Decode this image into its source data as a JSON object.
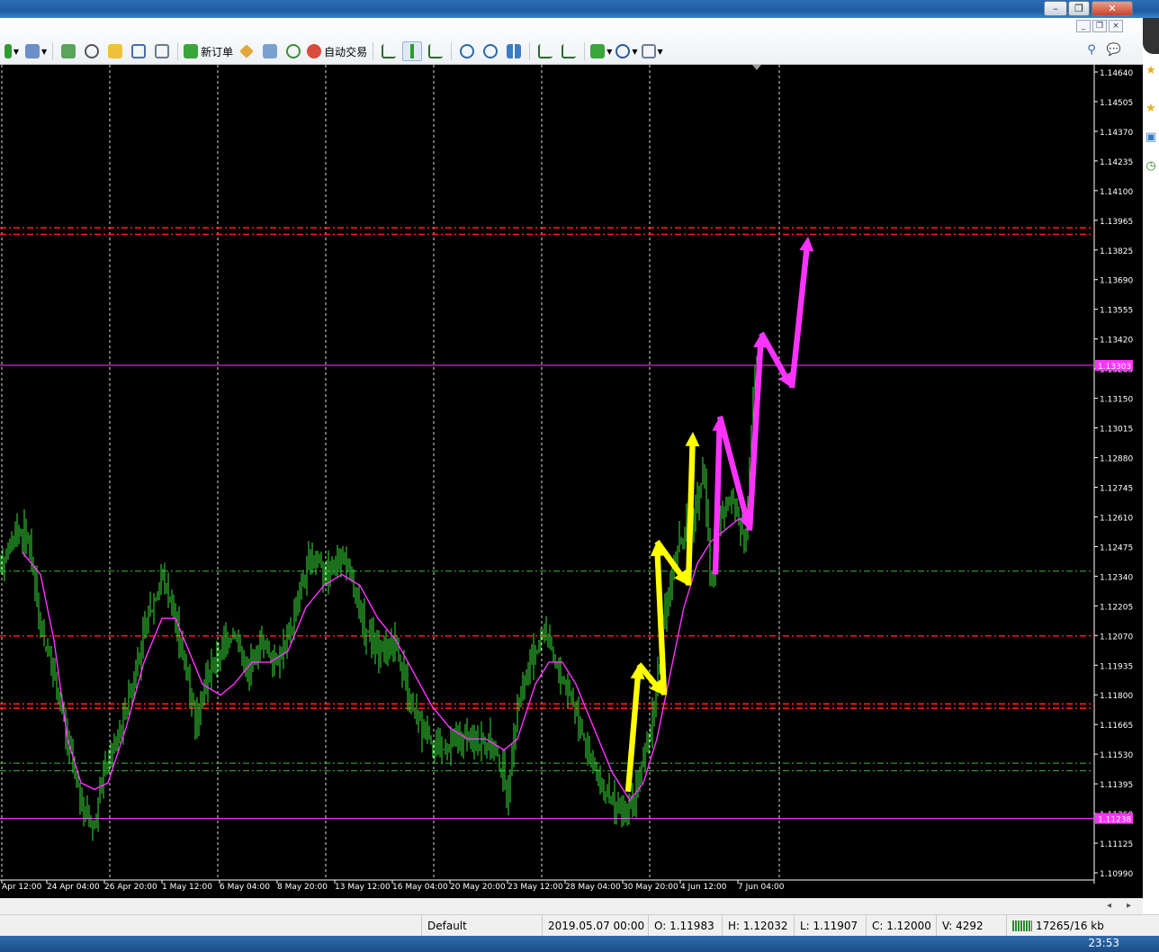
{
  "window": {
    "minimize_glyph": "–",
    "restore_glyph": "❐",
    "close_glyph": "✕"
  },
  "mdi": {
    "minimize_glyph": "_",
    "restore_glyph": "❐",
    "close_glyph": "×"
  },
  "toolbar": {
    "new_order_label": "新订单",
    "auto_trading_label": "自动交易"
  },
  "chart_data": {
    "type": "candlestick",
    "y_ticks": [
      "1.14640",
      "1.14505",
      "1.14370",
      "1.14235",
      "1.14100",
      "1.13965",
      "1.13825",
      "1.13690",
      "1.13555",
      "1.13420",
      "1.13285",
      "1.13150",
      "1.13015",
      "1.12880",
      "1.12745",
      "1.12610",
      "1.12475",
      "1.12340",
      "1.12205",
      "1.12070",
      "1.11935",
      "1.11800",
      "1.11665",
      "1.11530",
      "1.11395",
      "1.11260",
      "1.11125",
      "1.10990"
    ],
    "x_ticks": [
      "Apr 12:00",
      "24 Apr 04:00",
      "26 Apr 20:00",
      "1 May 12:00",
      "6 May 04:00",
      "8 May 20:00",
      "13 May 12:00",
      "16 May 04:00",
      "20 May 20:00",
      "23 May 12:00",
      "28 May 04:00",
      "30 May 20:00",
      "4 Jun 12:00",
      "7 Jun 04:00"
    ],
    "ylim": [
      1.1099,
      1.1464
    ],
    "price_labels": [
      "1.13303",
      "1.11238"
    ],
    "horizontal_lines": [
      {
        "price": 1.1393,
        "color": "#ff2020",
        "style": "dashdot"
      },
      {
        "price": 1.139,
        "color": "#ff2020",
        "style": "dashdot"
      },
      {
        "price": 1.13303,
        "color": "#ff33ff",
        "style": "solid"
      },
      {
        "price": 1.12365,
        "color": "#3cb43c",
        "style": "dashdot"
      },
      {
        "price": 1.1207,
        "color": "#ff2020",
        "style": "dashdot"
      },
      {
        "price": 1.1176,
        "color": "#ff2020",
        "style": "dashdot"
      },
      {
        "price": 1.1174,
        "color": "#ff2020",
        "style": "dashdot"
      },
      {
        "price": 1.1149,
        "color": "#3cb43c",
        "style": "dashdot"
      },
      {
        "price": 1.11455,
        "color": "#3cb43c",
        "style": "dashdot"
      },
      {
        "price": 1.11238,
        "color": "#ff33ff",
        "style": "solid"
      }
    ],
    "candle_color": "#39e039",
    "ma_color": "#ff33ff",
    "price_path": [
      [
        0,
        1.124
      ],
      [
        20,
        1.1255
      ],
      [
        32,
        1.1252
      ],
      [
        45,
        1.121
      ],
      [
        60,
        1.119
      ],
      [
        75,
        1.116
      ],
      [
        90,
        1.113
      ],
      [
        105,
        1.112
      ],
      [
        115,
        1.1145
      ],
      [
        130,
        1.116
      ],
      [
        150,
        1.119
      ],
      [
        165,
        1.1215
      ],
      [
        180,
        1.1235
      ],
      [
        192,
        1.122
      ],
      [
        205,
        1.1195
      ],
      [
        218,
        1.117
      ],
      [
        232,
        1.119
      ],
      [
        245,
        1.12
      ],
      [
        260,
        1.121
      ],
      [
        275,
        1.119
      ],
      [
        290,
        1.1205
      ],
      [
        305,
        1.1195
      ],
      [
        320,
        1.1205
      ],
      [
        335,
        1.123
      ],
      [
        350,
        1.1245
      ],
      [
        365,
        1.1235
      ],
      [
        380,
        1.1245
      ],
      [
        392,
        1.123
      ],
      [
        405,
        1.121
      ],
      [
        420,
        1.12
      ],
      [
        440,
        1.1205
      ],
      [
        455,
        1.1175
      ],
      [
        470,
        1.1165
      ],
      [
        490,
        1.1155
      ],
      [
        510,
        1.116
      ],
      [
        530,
        1.116
      ],
      [
        550,
        1.1155
      ],
      [
        565,
        1.1135
      ],
      [
        575,
        1.1175
      ],
      [
        590,
        1.1195
      ],
      [
        605,
        1.121
      ],
      [
        620,
        1.119
      ],
      [
        635,
        1.118
      ],
      [
        650,
        1.116
      ],
      [
        665,
        1.114
      ],
      [
        680,
        1.113
      ],
      [
        695,
        1.1125
      ],
      [
        710,
        1.114
      ],
      [
        725,
        1.117
      ],
      [
        740,
        1.122
      ],
      [
        755,
        1.125
      ],
      [
        770,
        1.126
      ],
      [
        782,
        1.1285
      ],
      [
        790,
        1.123
      ],
      [
        800,
        1.126
      ],
      [
        815,
        1.127
      ],
      [
        828,
        1.125
      ],
      [
        838,
        1.132
      ],
      [
        845,
        1.1335
      ]
    ],
    "ma_path": [
      [
        25,
        1.1245
      ],
      [
        45,
        1.1235
      ],
      [
        60,
        1.1205
      ],
      [
        75,
        1.116
      ],
      [
        90,
        1.114
      ],
      [
        105,
        1.1137
      ],
      [
        120,
        1.114
      ],
      [
        140,
        1.1165
      ],
      [
        160,
        1.1195
      ],
      [
        180,
        1.1215
      ],
      [
        195,
        1.1215
      ],
      [
        210,
        1.12
      ],
      [
        225,
        1.1185
      ],
      [
        245,
        1.118
      ],
      [
        260,
        1.1185
      ],
      [
        280,
        1.1195
      ],
      [
        300,
        1.1195
      ],
      [
        320,
        1.12
      ],
      [
        340,
        1.122
      ],
      [
        360,
        1.123
      ],
      [
        380,
        1.1235
      ],
      [
        400,
        1.123
      ],
      [
        420,
        1.1215
      ],
      [
        440,
        1.1205
      ],
      [
        460,
        1.119
      ],
      [
        480,
        1.1175
      ],
      [
        500,
        1.1165
      ],
      [
        520,
        1.116
      ],
      [
        540,
        1.116
      ],
      [
        560,
        1.1155
      ],
      [
        575,
        1.116
      ],
      [
        595,
        1.1185
      ],
      [
        610,
        1.1195
      ],
      [
        625,
        1.1195
      ],
      [
        640,
        1.1185
      ],
      [
        660,
        1.1165
      ],
      [
        680,
        1.1145
      ],
      [
        700,
        1.1132
      ],
      [
        715,
        1.114
      ],
      [
        730,
        1.116
      ],
      [
        745,
        1.119
      ],
      [
        760,
        1.122
      ],
      [
        775,
        1.124
      ],
      [
        790,
        1.125
      ],
      [
        805,
        1.1255
      ],
      [
        820,
        1.126
      ],
      [
        835,
        1.126
      ]
    ],
    "arrows": [
      {
        "color": "#ffff00",
        "points": [
          [
            698,
            1.1136
          ],
          [
            710,
            1.1194
          ]
        ]
      },
      {
        "color": "#ffff00",
        "points": [
          [
            710,
            1.1194
          ],
          [
            738,
            1.118
          ]
        ]
      },
      {
        "color": "#ffff00",
        "points": [
          [
            738,
            1.118
          ],
          [
            730,
            1.125
          ]
        ]
      },
      {
        "color": "#ffff00",
        "points": [
          [
            730,
            1.125
          ],
          [
            765,
            1.123
          ]
        ]
      },
      {
        "color": "#ffff00",
        "points": [
          [
            765,
            1.123
          ],
          [
            770,
            1.13
          ]
        ]
      },
      {
        "color": "#ff33ff",
        "points": [
          [
            795,
            1.1235
          ],
          [
            800,
            1.1307
          ]
        ]
      },
      {
        "color": "#ff33ff",
        "points": [
          [
            800,
            1.1307
          ],
          [
            833,
            1.1255
          ]
        ]
      },
      {
        "color": "#ff33ff",
        "points": [
          [
            833,
            1.1255
          ],
          [
            846,
            1.1345
          ]
        ]
      },
      {
        "color": "#ff33ff",
        "points": [
          [
            846,
            1.1345
          ],
          [
            880,
            1.132
          ]
        ]
      },
      {
        "color": "#ff33ff",
        "points": [
          [
            880,
            1.132
          ],
          [
            898,
            1.1389
          ]
        ]
      }
    ]
  },
  "status": {
    "profile": "Default",
    "datetime": "2019.05.07 00:00",
    "open": "O: 1.11983",
    "high": "H: 1.12032",
    "low": "L: 1.11907",
    "close": "C: 1.12000",
    "volume": "V: 4292",
    "traffic": "17265/16 kb"
  },
  "taskbar": {
    "clock": "23:53"
  },
  "icons": [
    "plus-icon",
    "new-chart-icon",
    "market-watch-icon",
    "crosshair-icon",
    "favorites-icon",
    "navigator-icon",
    "zoom-icon",
    "new-order-icon",
    "market-icon",
    "signals-icon",
    "auto-trading-icon",
    "bar-chart-icon",
    "candle-chart-icon",
    "line-chart-icon",
    "zoom-in-icon",
    "zoom-out-icon",
    "tile-windows-icon",
    "autoscroll-icon",
    "chart-shift-icon",
    "indicators-icon",
    "periods-icon",
    "templates-icon",
    "search-icon",
    "chat-icon"
  ]
}
